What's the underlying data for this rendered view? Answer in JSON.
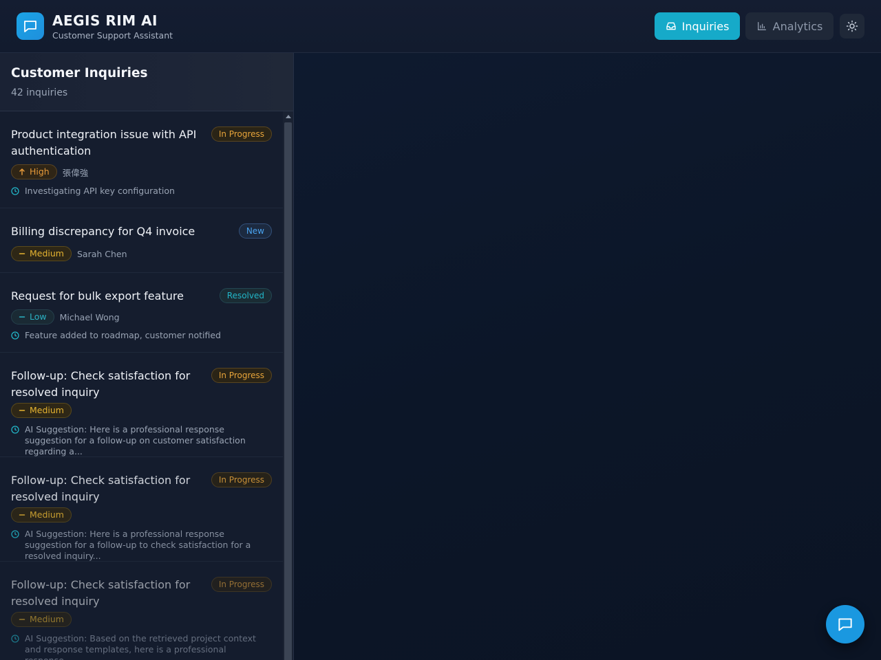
{
  "header": {
    "title": "AEGIS RIM AI",
    "subtitle": "Customer Support Assistant",
    "logo_icon": "chat-bubble-icon",
    "nav": {
      "inquiries_label": "Inquiries",
      "analytics_label": "Analytics"
    },
    "theme_icon": "sun-icon"
  },
  "sidebar": {
    "title": "Customer Inquiries",
    "count": "42 inquiries",
    "items": [
      {
        "title": "Product integration issue with API authentication",
        "status": "In Progress",
        "priority": "High",
        "priority_icon": "arrow-up-icon",
        "assignee": "張偉強",
        "note": "Investigating API key configuration"
      },
      {
        "title": "Billing discrepancy for Q4 invoice",
        "status": "New",
        "priority": "Medium",
        "priority_icon": "minus-icon",
        "assignee": "Sarah Chen"
      },
      {
        "title": "Request for bulk export feature",
        "status": "Resolved",
        "priority": "Low",
        "priority_icon": "minus-icon",
        "assignee": "Michael Wong",
        "note": "Feature added to roadmap, customer notified"
      },
      {
        "title": "Follow-up: Check satisfaction for resolved inquiry",
        "status": "In Progress",
        "priority": "Medium",
        "priority_icon": "minus-icon",
        "note": "AI Suggestion: Here is a professional response suggestion for a follow-up on customer satisfaction regarding a..."
      },
      {
        "title": "Follow-up: Check satisfaction for resolved inquiry",
        "status": "In Progress",
        "priority": "Medium",
        "priority_icon": "minus-icon",
        "note": "AI Suggestion: Here is a professional response suggestion for a follow-up to check satisfaction for a resolved inquiry..."
      },
      {
        "title": "Follow-up: Check satisfaction for resolved inquiry",
        "status": "In Progress",
        "priority": "Medium",
        "priority_icon": "minus-icon",
        "note": "AI Suggestion: Based on the retrieved project context and response templates, here is a professional response..."
      }
    ]
  },
  "fab": {
    "icon": "chat-bubble-icon"
  },
  "colors": {
    "accent": "#16aac9",
    "fab": "#1a98e0",
    "in_progress": "#e7a43a",
    "new": "#4aa3f0",
    "resolved": "#22b6c8",
    "high": "#e79a3a",
    "medium": "#e6b431",
    "low": "#2bb3c4"
  }
}
